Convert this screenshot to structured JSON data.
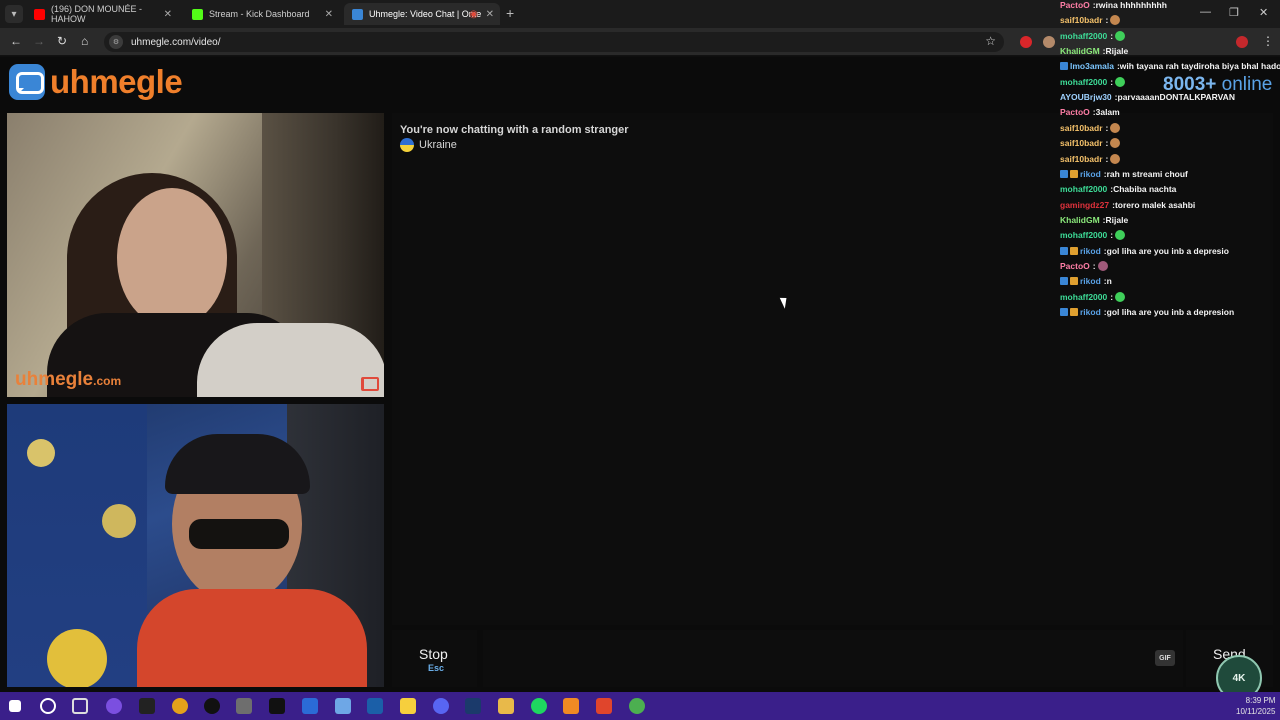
{
  "browser": {
    "tabs": [
      {
        "title": "(196) DON MOUNÉE - HAHOW",
        "color": "#ff0000",
        "active": false
      },
      {
        "title": "Stream - Kick Dashboard",
        "color": "#53fc18",
        "active": false
      },
      {
        "title": "Uhmegle: Video Chat | Ome",
        "color": "#3a86d6",
        "active": true
      }
    ],
    "url": "uhmegle.com/video/"
  },
  "site": {
    "logo_text": "uhmegle",
    "online_count": "8003+",
    "online_label": "online"
  },
  "videos": {
    "stranger_watermark": "uhmegle",
    "stranger_watermark_suffix": ".com"
  },
  "chat": {
    "status_text": "You're now chatting with a random stranger",
    "country": "Ukraine"
  },
  "controls": {
    "stop_label": "Stop",
    "stop_shortcut": "Esc",
    "gif_label": "GIF",
    "send_label": "Send"
  },
  "stream_chat": [
    {
      "user": "PactoO",
      "user_color": "#ff7ea6",
      "text": "rwina hhhhhhhhh"
    },
    {
      "user": "saif10badr",
      "user_color": "#f5c26b",
      "text": ""
    },
    {
      "user": "mohaff2000",
      "user_color": "#3ddc97",
      "text": ""
    },
    {
      "user": "KhalidGM",
      "user_color": "#8be97b",
      "text": "Rijale"
    },
    {
      "user": "lmo3amala",
      "user_color": "#7cc6ff",
      "text": "wih tayana rah taydiroha biya bhal hado j"
    },
    {
      "user": "mohaff2000",
      "user_color": "#3ddc97",
      "text": ""
    },
    {
      "user": "AYOUBrjw30",
      "user_color": "#9fd2ff",
      "text": "parvaaaanDONTALKPARVAN"
    },
    {
      "user": "PactoO",
      "user_color": "#ff7ea6",
      "text": "3alam"
    },
    {
      "user": "saif10badr",
      "user_color": "#f5c26b",
      "text": ""
    },
    {
      "user": "saif10badr",
      "user_color": "#f5c26b",
      "text": ""
    },
    {
      "user": "saif10badr",
      "user_color": "#f5c26b",
      "text": ""
    },
    {
      "user": "rikod",
      "user_color": "#5aa2e6",
      "text": "rah m streami chouf"
    },
    {
      "user": "mohaff2000",
      "user_color": "#3ddc97",
      "text": "Chabiba nachta"
    },
    {
      "user": "gamingdz27",
      "user_color": "#e0323c",
      "text": "torero malek asahbi"
    },
    {
      "user": "KhalidGM",
      "user_color": "#8be97b",
      "text": "Rijale"
    },
    {
      "user": "mohaff2000",
      "user_color": "#3ddc97",
      "text": ""
    },
    {
      "user": "rikod",
      "user_color": "#5aa2e6",
      "text": "gol liha are you inb a depresio"
    },
    {
      "user": "PactoO",
      "user_color": "#ff7ea6",
      "text": ""
    },
    {
      "user": "rikod",
      "user_color": "#5aa2e6",
      "text": "n"
    },
    {
      "user": "mohaff2000",
      "user_color": "#3ddc97",
      "text": ""
    },
    {
      "user": "rikod",
      "user_color": "#5aa2e6",
      "text": "gol liha are you inb a depresion"
    }
  ],
  "overlay_badge": "4K",
  "taskbar": {
    "time": "8:39 PM",
    "date": "10/11/2025"
  }
}
